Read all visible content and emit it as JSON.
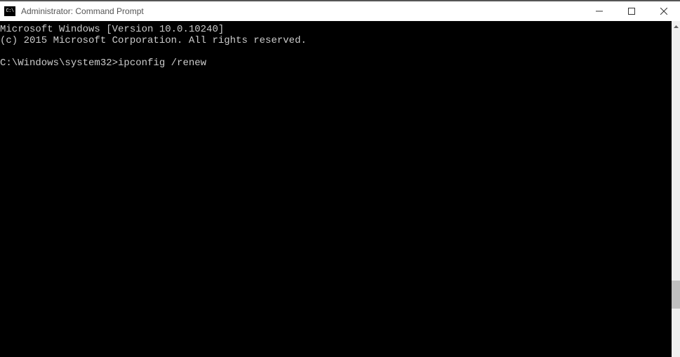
{
  "window": {
    "title": "Administrator: Command Prompt",
    "icon_label": "C:\\"
  },
  "terminal": {
    "line1": "Microsoft Windows [Version 10.0.10240]",
    "line2": "(c) 2015 Microsoft Corporation. All rights reserved.",
    "prompt": "C:\\Windows\\system32>",
    "command": "ipconfig /renew"
  }
}
